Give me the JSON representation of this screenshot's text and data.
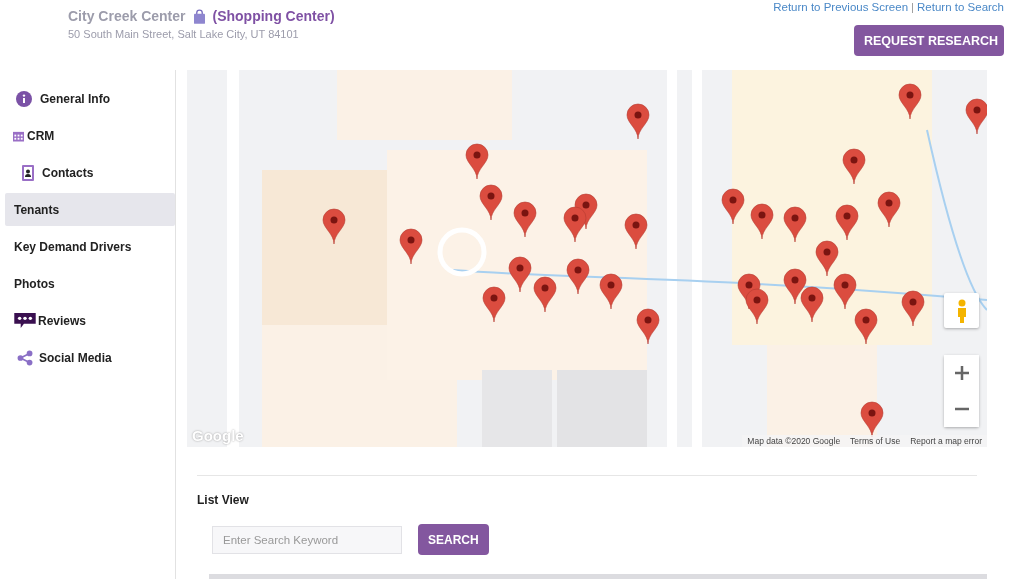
{
  "header": {
    "title": "City Creek Center",
    "category": "(Shopping Center)",
    "address": "50 South Main Street, Salt Lake City, UT 84101",
    "links": [
      "Return to Previous Screen",
      "Return to Search"
    ],
    "separator": "|",
    "button": "REQUEST RESEARCH"
  },
  "sidebar": {
    "items": [
      {
        "label": "General Info",
        "kind": "info",
        "selected": false
      },
      {
        "label": "CRM",
        "kind": "calendar",
        "selected": false
      },
      {
        "label": "Contacts",
        "kind": "contact",
        "selected": false
      },
      {
        "label": "Tenants",
        "kind": "plain",
        "selected": true
      },
      {
        "label": "Key Demand Drivers",
        "kind": "plain",
        "selected": false
      },
      {
        "label": "Photos",
        "kind": "plain",
        "selected": false
      },
      {
        "label": "Reviews",
        "kind": "reviews",
        "selected": false
      },
      {
        "label": "Social Media",
        "kind": "share",
        "selected": false
      }
    ]
  },
  "map": {
    "kind": "picture",
    "logo": "Google",
    "attribution": [
      "Map data ©2020 Google",
      "Terms of Use",
      "Report a map error"
    ]
  },
  "list_view": {
    "title": "List View",
    "search": {
      "placeholder": "Enter Search Keyword"
    },
    "button": "SEARCH"
  }
}
